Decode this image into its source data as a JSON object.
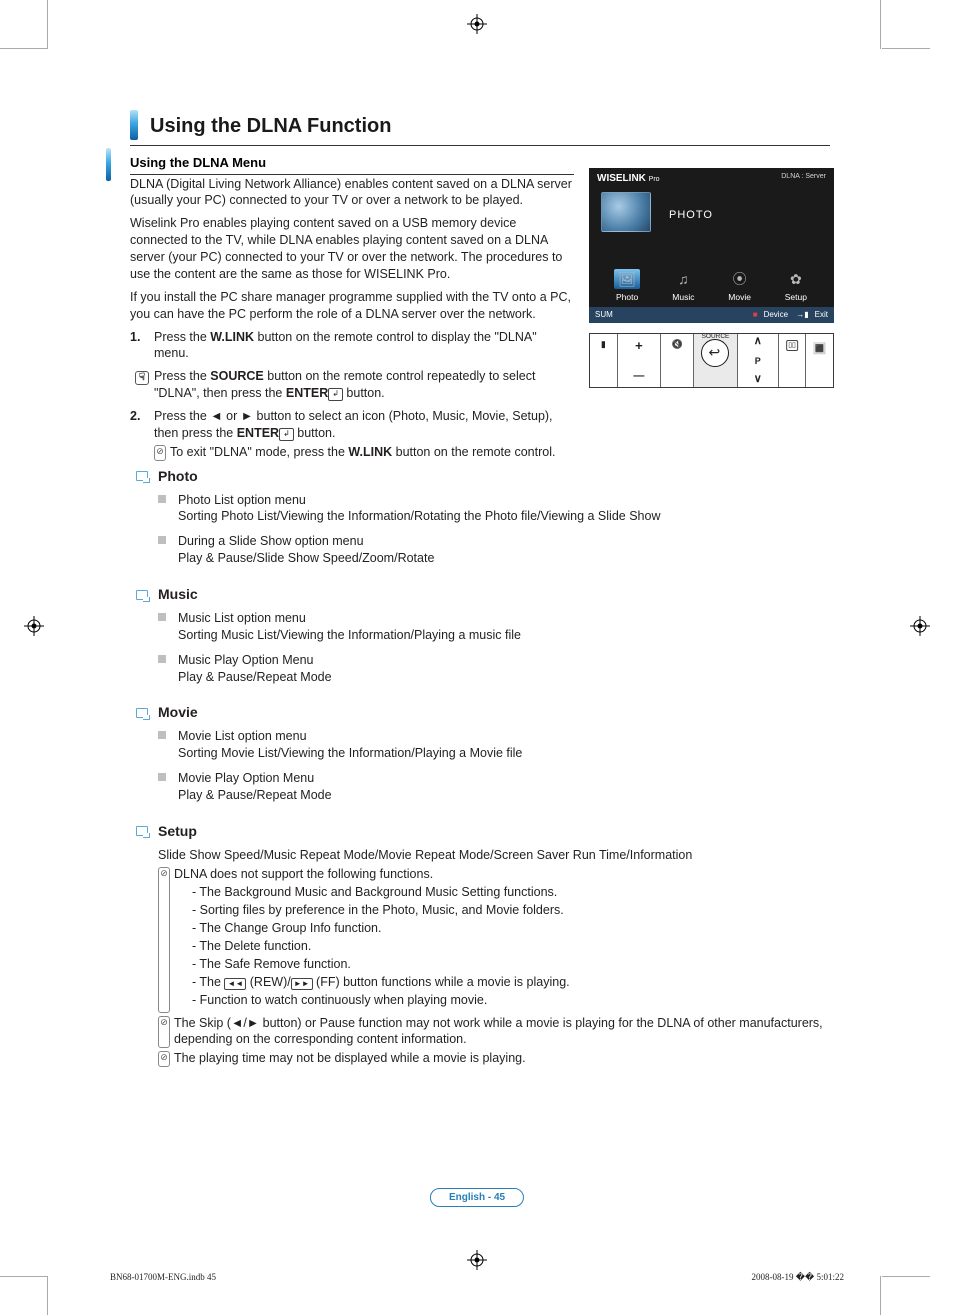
{
  "header": {
    "title": "Using the DLNA Function"
  },
  "subheader": {
    "title": "Using the DLNA Menu"
  },
  "intro": {
    "p1": "DLNA (Digital Living Network Alliance) enables content saved on a DLNA server (usually your PC) connected to your TV or over a network to be played.",
    "p2": "Wiselink Pro enables playing content saved on a USB memory device connected to the TV, while DLNA enables playing content saved on a DLNA server (your PC) connected to your TV or over the network. The procedures to use the content are the same as those for WISELINK Pro.",
    "p3": "If you install the PC share manager programme supplied with the TV onto a PC, you can have the PC perform the role of a DLNA server over the network."
  },
  "steps": {
    "s1_pre": "Press the ",
    "s1_btn": "W.LINK",
    "s1_post": " button on the remote control to display the \"DLNA\" menu.",
    "s1b_pre": "Press the ",
    "s1b_btn": "SOURCE",
    "s1b_mid": " button on the remote control repeatedly to select \"DLNA\", then press the ",
    "s1b_btn2": "ENTER",
    "s1b_post": " button.",
    "s2_pre": "Press the ◄ or ► button to select an icon (Photo, Music, Movie, Setup), then press the ",
    "s2_btn": "ENTER",
    "s2_post": " button.",
    "s2_note_pre": "To exit \"DLNA\" mode, press the ",
    "s2_note_btn": "W.LINK",
    "s2_note_post": " button on the remote control."
  },
  "photo": {
    "head": "Photo",
    "i1_t": "Photo List option menu",
    "i1_d": "Sorting Photo List/Viewing the Information/Rotating the Photo file/Viewing a Slide Show",
    "i2_t": "During a Slide Show option menu",
    "i2_d": "Play & Pause/Slide Show Speed/Zoom/Rotate"
  },
  "music": {
    "head": "Music",
    "i1_t": "Music List option menu",
    "i1_d": "Sorting Music List/Viewing the Information/Playing a music file",
    "i2_t": "Music Play Option Menu",
    "i2_d": "Play & Pause/Repeat Mode"
  },
  "movie": {
    "head": "Movie",
    "i1_t": "Movie List option menu",
    "i1_d": "Sorting Movie List/Viewing the Information/Playing a Movie file",
    "i2_t": "Movie Play Option Menu",
    "i2_d": "Play & Pause/Repeat Mode"
  },
  "setup": {
    "head": "Setup",
    "line": "Slide Show Speed/Music Repeat Mode/Movie Repeat Mode/Screen Saver Run Time/Information",
    "n1": "DLNA does not support the following functions.",
    "d1": "The Background Music and Background Music Setting functions.",
    "d2": "Sorting files by preference in the Photo, Music, and Movie folders.",
    "d3": "The Change Group Info function.",
    "d4": "The Delete function.",
    "d5": "The Safe Remove function.",
    "d6_pre": "The ",
    "d6_mid": " (REW)/",
    "d6_post": " (FF) button functions while a movie is playing.",
    "d7": "Function to watch continuously when playing movie.",
    "n2": "The Skip (◄/► button) or Pause function may not work while a movie is playing for the DLNA of other manufacturers, depending on the corresponding content information.",
    "n3": "The playing time may not be displayed while a movie is playing."
  },
  "tv": {
    "brand": "WISELINK",
    "brand_sub": "Pro",
    "source": "DLNA : Server",
    "big": "PHOTO",
    "ic1": "Photo",
    "ic2": "Music",
    "ic3": "Movie",
    "ic4": "Setup",
    "foot_l": "SUM",
    "foot_r1": "Device",
    "foot_r2": "Exit"
  },
  "remote": {
    "source": "SOURCE",
    "p": "P"
  },
  "page_no": "English - 45",
  "footer_left": "BN68-01700M-ENG.indb   45",
  "footer_right": "2008-08-19   �� 5:01:22"
}
